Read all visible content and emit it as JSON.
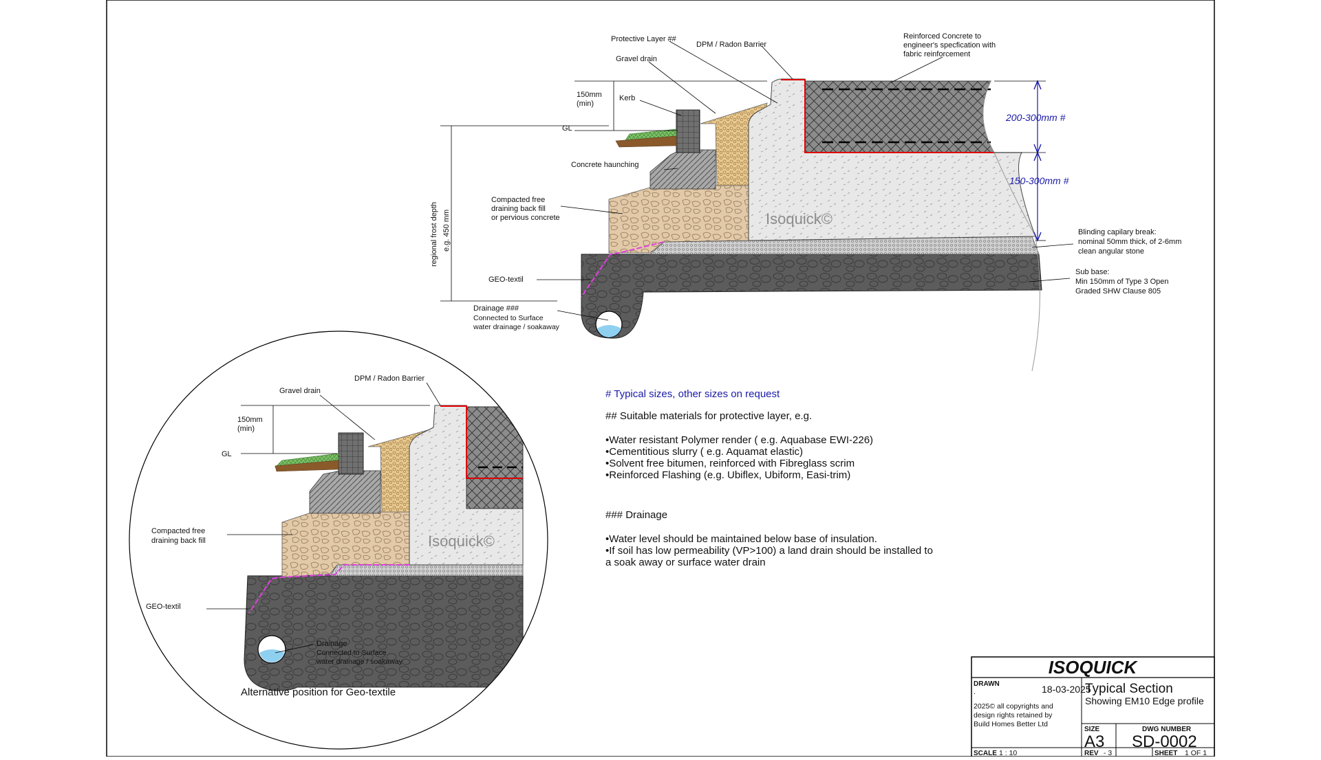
{
  "labels": {
    "protective_layer": "Protective Layer ##",
    "dpm_radon": "DPM / Radon Barrier",
    "reinforced_concrete": [
      "Reinforced Concrete to",
      "engineer's specfication with",
      "fabric reinforcement"
    ],
    "gravel_drain": "Gravel drain",
    "min_150": [
      "150mm",
      "(min)"
    ],
    "kerb": "Kerb",
    "gl": "GL",
    "concrete_haunching": "Concrete haunching",
    "backfill": [
      "Compacted free",
      "draining back fill",
      "or pervious concrete"
    ],
    "frost_depth": [
      "regional frost depth",
      "e.g. 450 mm"
    ],
    "geo_textil": "GEO-textil",
    "drainage": [
      "Drainage ###",
      "Connected to Surface",
      "water drainage / soakaway"
    ],
    "dim_200_300": "200-300mm #",
    "dim_150_300": "150-300mm #",
    "blinding": [
      "Blinding  capilary break:",
      "nominal 50mm thick, of 2-6mm",
      "clean angular stone"
    ],
    "sub_base": [
      "Sub base:",
      "Min 150mm of Type 3 Open",
      "Graded SHW Clause 805"
    ],
    "watermark": "Isoquick©"
  },
  "detail": {
    "gravel_drain": "Gravel drain",
    "dpm_radon": "DPM / Radon Barrier",
    "min_150": [
      "150mm",
      "(min)"
    ],
    "gl": "GL",
    "backfill": [
      "Compacted free",
      "draining back fill"
    ],
    "geo_textil": "GEO-textil",
    "drainage": [
      "Drainage",
      "Connected to Surface",
      "water drainage / soakaway"
    ],
    "caption": "Alternative position for Geo-textile",
    "watermark": "Isoquick©"
  },
  "notes": {
    "typical": "# Typical sizes, other sizes on request",
    "materials_head": "## Suitable materials for protective layer, e.g.",
    "materials": [
      "•Water resistant Polymer render ( e.g. Aquabase EWI-226)",
      "•Cementitious slurry ( e.g. Aquamat  elastic)",
      "•Solvent free bitumen, reinforced with Fibreglass scrim",
      "•Reinforced Flashing (e.g. Ubiflex, Ubiform, Easi-trim)"
    ],
    "drainage_head": "### Drainage",
    "drainage": [
      "•Water level should be maintained below base of insulation.",
      "•If soil has low permeability (VP>100) a land drain should be installed to",
      "a soak away or surface water drain"
    ]
  },
  "titleblock": {
    "company": "ISOQUICK",
    "drawn_label": "DRAWN",
    "drawn_dot": ".",
    "date": "18-03-2025",
    "copyright": [
      "2025© all copyrights and",
      "design rights retained by",
      "Build Homes Better Ltd"
    ],
    "title": "Typical Section",
    "subtitle": "Showing EM10 Edge profile",
    "size_label": "SIZE",
    "size": "A3",
    "dwg_label": "DWG NUMBER",
    "dwg": "SD-0002",
    "scale_label": "SCALE",
    "scale": "1 : 10",
    "rev_label": "REV",
    "rev": "- 3",
    "sheet_label": "SHEET",
    "sheet": "1 OF 1"
  },
  "colors": {
    "concrete": "#8c8c8c",
    "insulation": "#e6e6e6",
    "subbase": "#5a5a5a",
    "backfill": "#e2c9a8",
    "gravel": "#e8c990",
    "grass": "#7fbf6a",
    "soil": "#8a5a2b",
    "dpm": "#e00000",
    "geotextile": "#e040e0",
    "water": "#8fd0f0",
    "dim_blue": "#1a1aa8"
  }
}
